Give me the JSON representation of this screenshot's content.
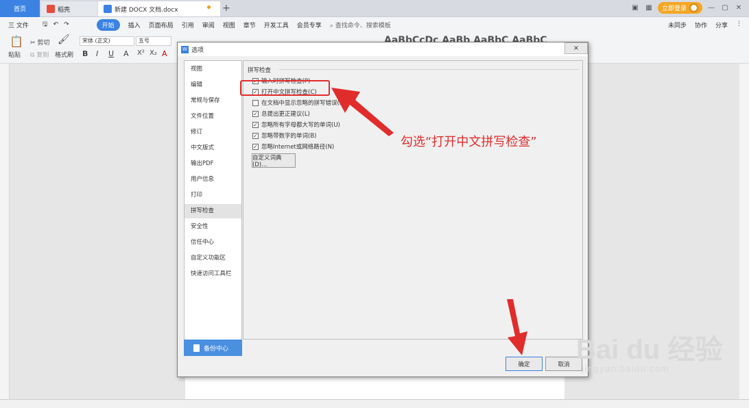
{
  "tabs": {
    "home": "首页",
    "wps": "稻壳",
    "doc": "新建 DOCX 文档.docx",
    "plus": "+",
    "login": "立即登录"
  },
  "menu": {
    "items": [
      "三 文件",
      "开始",
      "插入",
      "页面布局",
      "引用",
      "审阅",
      "视图",
      "章节",
      "开发工具",
      "会员专享"
    ],
    "search": "查找命令、搜索模板",
    "right": [
      "未同步",
      "协作",
      "分享"
    ]
  },
  "ribbon": {
    "paste": "粘贴",
    "cut": "剪切",
    "copy": "复制",
    "format_painter": "格式刷",
    "font_name": "宋体 (正文)",
    "font_size": "五号",
    "bold": "B",
    "styles": "AaBbCcDc AaBb AaBbC AaBbC"
  },
  "dialog": {
    "title": "选项",
    "close": "×",
    "nav": [
      "视图",
      "编辑",
      "常规与保存",
      "文件位置",
      "修订",
      "中文版式",
      "输出PDF",
      "用户信息",
      "打印",
      "拼写检查",
      "安全性",
      "信任中心",
      "自定义功能区",
      "快速访问工具栏"
    ],
    "selected_nav": "拼写检查",
    "backup": "备份中心",
    "section": "拼写检查",
    "options": [
      {
        "label": "输入时拼写检查(P)",
        "checked": true
      },
      {
        "label": "打开中文拼写检查(C)",
        "checked": true
      },
      {
        "label": "在文档中显示忽略的拼写错误(S)",
        "checked": false
      },
      {
        "label": "总提出更正建议(L)",
        "checked": true
      },
      {
        "label": "忽略所有字母都大写的单词(U)",
        "checked": true
      },
      {
        "label": "忽略带数字的单词(B)",
        "checked": true
      },
      {
        "label": "忽略Internet或网络路径(N)",
        "checked": true
      }
    ],
    "custom_dict": "自定义词典(D)...",
    "ok": "确定",
    "cancel": "取消"
  },
  "annotation": {
    "text": "勾选“打开中文拼写检查”",
    "color": "#e12c2c"
  },
  "watermark": {
    "logo": "Bai du 经验",
    "url": "jingyan.baidu.com"
  }
}
